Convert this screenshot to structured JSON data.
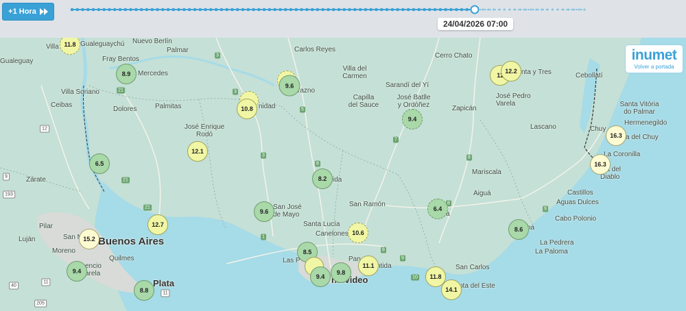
{
  "toolbar": {
    "hour_button_label": "+1 Hora",
    "timestamp": "24/04/2026 07:00",
    "timeline_progress": 0.79
  },
  "logo": {
    "brand": "inumet",
    "back_link": "Volver a portada"
  },
  "colors": {
    "accent": "#3aa1d6",
    "marker_green": "#a9d8a9",
    "marker_yellow": "#f1f6a4",
    "marker_cream": "#fdfbd2",
    "sea": "#a6dbe8",
    "land": "#c5e0d6"
  },
  "city_labels": {
    "villa_larr": "Villa Larr",
    "gualeguaychu": "Gualeguaychú",
    "nuevo_berlin": "Nuevo Berlín",
    "palmar": "Palmar",
    "carlos_reyes": "Carlos Reyes",
    "cerro_chato": "Cerro Chato",
    "gualeguay": "Gualeguay",
    "fray_bentos": "Fray Bentos",
    "mercedes": "Mercedes",
    "villa_del_carmen": "Villa del\nCarmen",
    "durazno": "razno",
    "sarandi": "Sarandí del Yí",
    "treinta_y_tres": "nta y Tres",
    "cebollati": "Cebollatí",
    "villa_soriano": "Villa Soriano",
    "ceibas": "Ceibas",
    "dolores": "Dolores",
    "palmitas": "Palmitas",
    "trinidad": "nidad",
    "capilla": "Capilla\ndel Sauce",
    "jose_batlle": "José Batlle\ny Ordóñez",
    "jose_pedro_varela": "José Pedro\nVarela",
    "zapican": "Zapicán",
    "santa_vitoria": "Santa Vitória\ndo Palmar",
    "hermenegildo": "Hermenegildo",
    "jose_enrique_rodo": "José Enrique\nRodó",
    "lascano": "Lascano",
    "chuy": "Chuy",
    "barra_del_chuy": "a del Chuy",
    "la_coronilla": "La Coronilla",
    "punta_del_diablo": "nta del\nDiablo",
    "zarate": "Zárate",
    "florida": "ida",
    "mariscala": "Mariscala",
    "aigua": "Aiguá",
    "castillos": "Castillos",
    "aguas_dulces": "Aguas Dulces",
    "san_ramon": "San Ramón",
    "san_jose": "San José\nde Mayo",
    "minas": "a",
    "rocha": "ha",
    "cabo_polonio": "Cabo Polonio",
    "pilar": "Pilar",
    "santa_lucia": "Santa Lucía",
    "canelones": "Canelones",
    "lujan": "Luján",
    "san_martin": "San M",
    "buenos_aires": "Buenos Aires",
    "la_pedrera": "La Pedrera",
    "la_paloma": "La Paloma",
    "moreno": "Moreno",
    "las_piedras": "Las P",
    "pando": "Pan",
    "atlantida": "ntida",
    "quilmes": "Quilmes",
    "san_carlos": "San Carlos",
    "florencio_varela": "encio\narela",
    "montevideo": "ntevideo",
    "punta_del_este": "nta del Este",
    "la_plata": "Plata",
    "piriapolis": "P"
  },
  "route_shields": [
    "3",
    "21",
    "3",
    "5",
    "7",
    "8",
    "12",
    "9",
    "193",
    "3",
    "21",
    "8",
    "9",
    "21",
    "1",
    "8",
    "8",
    "9",
    "40",
    "11",
    "205",
    "11",
    "10"
  ],
  "stations": [
    {
      "value": "11.8"
    },
    {
      "value": "8.9"
    },
    {
      "value": "9.6"
    },
    {
      "value": "10.8"
    },
    {
      "value": "11"
    },
    {
      "value": "12.2"
    },
    {
      "value": "9.4"
    },
    {
      "value": "12.1"
    },
    {
      "value": "16.3"
    },
    {
      "value": "6.5"
    },
    {
      "value": "16.3"
    },
    {
      "value": "8.2"
    },
    {
      "value": "6.4"
    },
    {
      "value": "9.6"
    },
    {
      "value": "12.7"
    },
    {
      "value": "8.6"
    },
    {
      "value": "10.6"
    },
    {
      "value": "15.2"
    },
    {
      "value": "8.5"
    },
    {
      "value": "11.1"
    },
    {
      "value": "9.4"
    },
    {
      "value": "9.8"
    },
    {
      "value": "9.4"
    },
    {
      "value": "11.8"
    },
    {
      "value": "8.8"
    },
    {
      "value": "14.1"
    }
  ]
}
